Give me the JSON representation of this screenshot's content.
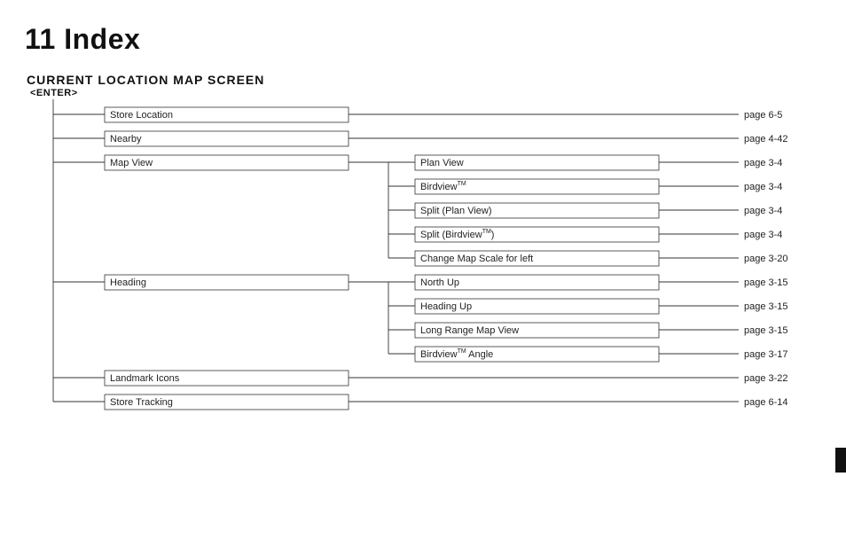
{
  "title": "11 Index",
  "section_heading": "CURRENT LOCATION MAP SCREEN",
  "subheading": "<ENTER>",
  "items": [
    {
      "label": "Store Location",
      "page": "page 6-5"
    },
    {
      "label": "Nearby",
      "page": "page 4-42"
    },
    {
      "label": "Map View",
      "children": [
        {
          "label": "Plan View",
          "page": "page 3-4"
        },
        {
          "label": "Birdview",
          "tm": true,
          "page": "page 3-4"
        },
        {
          "label": "Split (Plan View)",
          "page": "page 3-4"
        },
        {
          "label": "Split (Birdview",
          "tm": true,
          "suffix": ")",
          "page": "page 3-4"
        },
        {
          "label": "Change Map Scale for left",
          "page": "page 3-20"
        }
      ]
    },
    {
      "label": "Heading",
      "children": [
        {
          "label": "North Up",
          "page": "page 3-15"
        },
        {
          "label": "Heading Up",
          "page": "page 3-15"
        },
        {
          "label": "Long Range Map View",
          "page": "page 3-15"
        },
        {
          "label": "Birdview",
          "tm": true,
          "suffix": " Angle",
          "page": "page 3-17"
        }
      ]
    },
    {
      "label": "Landmark Icons",
      "page": "page 3-22"
    },
    {
      "label": "Store Tracking",
      "page": "page 6-14"
    }
  ],
  "row_y": {
    "store_location": 129,
    "nearby": 156,
    "map_view": 183,
    "plan_view": 183,
    "birdview": 210,
    "split_plan": 237,
    "split_bird": 264,
    "change_scale": 291,
    "heading": 318,
    "north_up": 318,
    "heading_up": 345,
    "long_range": 372,
    "bird_angle": 399,
    "landmark": 426,
    "store_track": 453
  }
}
